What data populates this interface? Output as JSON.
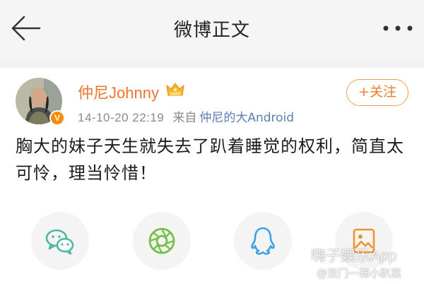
{
  "header": {
    "title": "微博正文",
    "back_icon": "arrow-left-icon",
    "more_icon": "more-dots-icon"
  },
  "post": {
    "username": "仲尼Johnny",
    "verified_icon": "v-badge-icon",
    "verified_glyph": "V",
    "member_icon": "crown-badge-icon",
    "follow_label": "+关注",
    "time": "14-10-20 22:19",
    "source_label": "来自",
    "source": "仲尼的大Android",
    "content": "胸大的妹子天生就失去了趴着睡觉的权利，简直太可怜，理当怜惜！"
  },
  "share": [
    {
      "name": "wechat",
      "icon": "wechat-icon"
    },
    {
      "name": "moments",
      "icon": "moments-icon"
    },
    {
      "name": "qq",
      "icon": "qq-icon"
    },
    {
      "name": "save-image",
      "icon": "image-icon"
    }
  ],
  "watermark": {
    "app": "嗨子娱乐App",
    "user": "@双门一梯小趴菜"
  },
  "colors": {
    "accent": "#f0762e",
    "link": "#5b7fb1",
    "header_bg": "#f5f5f5"
  }
}
